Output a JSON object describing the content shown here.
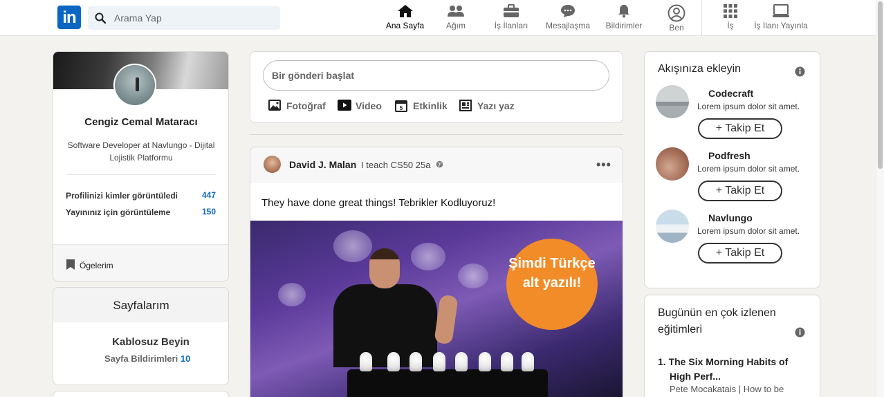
{
  "header": {
    "logo": "in",
    "search_placeholder": "Arama Yap",
    "nav": [
      {
        "label": "Ana Sayfa",
        "icon": "home-icon"
      },
      {
        "label": "Ağım",
        "icon": "network-icon"
      },
      {
        "label": "İş İlanları",
        "icon": "briefcase-icon"
      },
      {
        "label": "Mesajlaşma",
        "icon": "messaging-icon"
      },
      {
        "label": "Bildirimler",
        "icon": "bell-icon"
      },
      {
        "label": "Ben",
        "icon": "profile-icon"
      },
      {
        "label": "İş",
        "icon": "grid-icon"
      },
      {
        "label": "İş İlanı Yayınla",
        "icon": "post-job-icon"
      }
    ]
  },
  "profile": {
    "name": "Cengiz Cemal Mataracı",
    "headline": "Software Developer at Navlungo - Dijital Lojistik Platformu",
    "stats": [
      {
        "label": "Profilinizi kimler görüntüledi",
        "value": "447"
      },
      {
        "label": "Yayınınız için görüntüleme",
        "value": "150"
      }
    ],
    "items_label": "Ögelerim"
  },
  "pages": {
    "title": "Sayfalarım",
    "name": "Kablosuz Beyin",
    "notifications_label": "Sayfa Bildirimleri",
    "notifications_count": "10"
  },
  "share": {
    "placeholder": "Bir gönderi başlat",
    "actions": [
      {
        "label": "Fotoğraf",
        "icon": "photo-icon"
      },
      {
        "label": "Video",
        "icon": "video-icon"
      },
      {
        "label": "Etkinlik",
        "icon": "calendar-icon"
      },
      {
        "label": "Yazı yaz",
        "icon": "article-icon"
      }
    ]
  },
  "post": {
    "author": "David J. Malan",
    "meta": "I teach CS50 25a",
    "text": "They have done great things! Tebrikler Kodluyoruz!",
    "badge_text": "Şimdi Türkçe alt yazılı!"
  },
  "feed_suggestions": {
    "title": "Akışınıza ekleyin",
    "follow_label": "+ Takip Et",
    "items": [
      {
        "name": "Codecraft",
        "desc": "Lorem ipsum dolor sit amet."
      },
      {
        "name": "Podfresh",
        "desc": "Lorem ipsum dolor sit amet."
      },
      {
        "name": "Navlungo",
        "desc": "Lorem ipsum dolor sit amet."
      }
    ]
  },
  "trending": {
    "title": "Bugünün en çok izlenen eğitimleri",
    "item_number": "1.",
    "item_title": "The Six Morning Habits of High Perf...",
    "item_sub": "Pete Mocakatais | How to be"
  }
}
